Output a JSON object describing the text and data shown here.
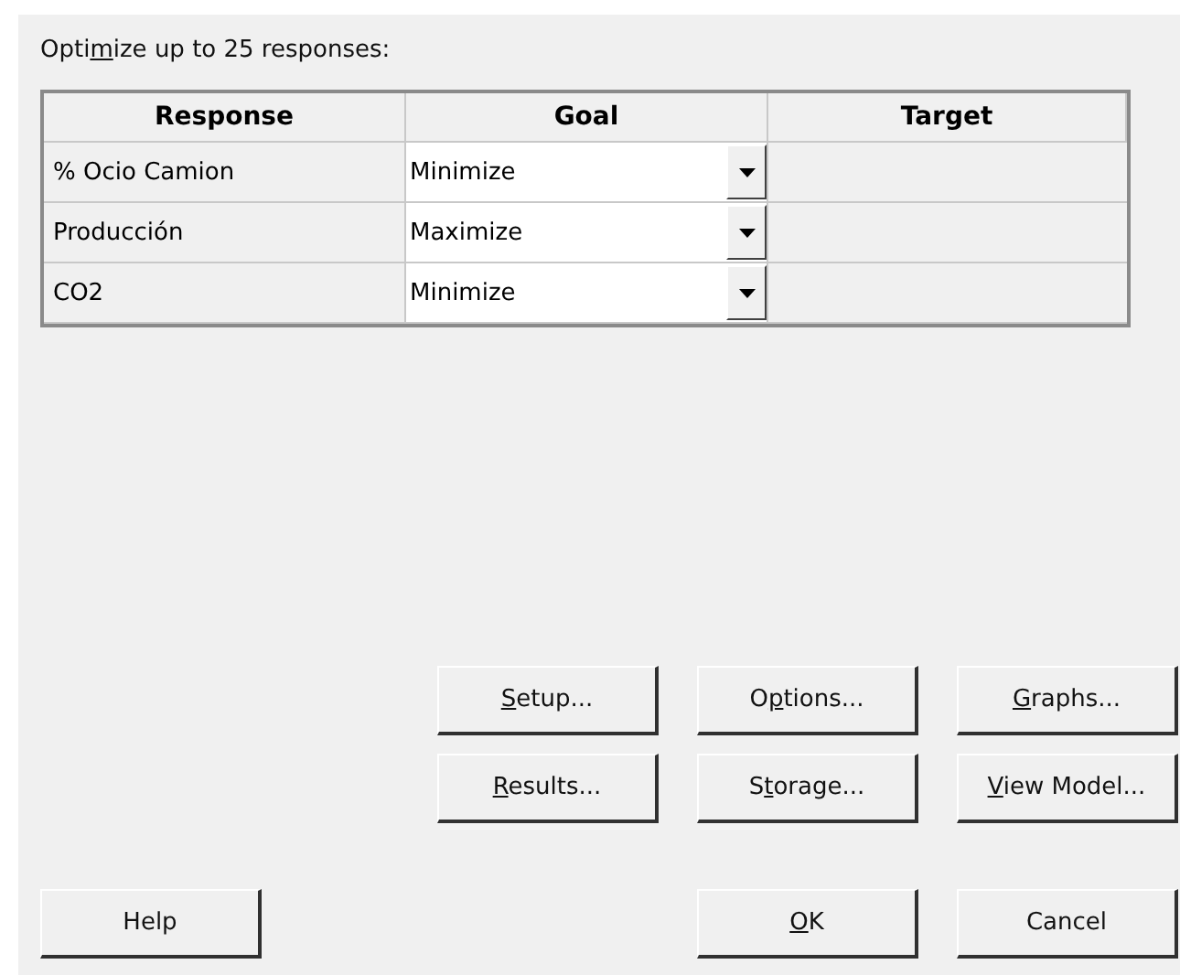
{
  "prompt": {
    "label_start": "Opti",
    "access_key": "m",
    "label_end": "ize up to 25 responses:"
  },
  "table": {
    "columns": [
      "Response",
      "Goal",
      "Target"
    ],
    "rows": [
      {
        "response": "% Ocio Camion",
        "goal": "Minimize"
      },
      {
        "response": "Producción",
        "goal": "Maximize"
      },
      {
        "response": "CO2",
        "goal": "Minimize"
      }
    ]
  },
  "buttons": [
    {
      "access_key": "S",
      "label_end": "etup..."
    },
    {
      "label_start": "O",
      "access_key": "p",
      "label_end": "tions..."
    },
    {
      "access_key": "G",
      "label_end": "raphs..."
    },
    {
      "access_key": "R",
      "label_end": "esults..."
    },
    {
      "label_start": "S",
      "access_key": "t",
      "label_end": "orage..."
    },
    {
      "access_key": "V",
      "label_end": "iew Model..."
    }
  ],
  "footer_buttons": [
    {
      "label_start": "Help"
    },
    {
      "access_key": "O",
      "label_end": "K"
    },
    {
      "label_start": "Cancel"
    }
  ]
}
